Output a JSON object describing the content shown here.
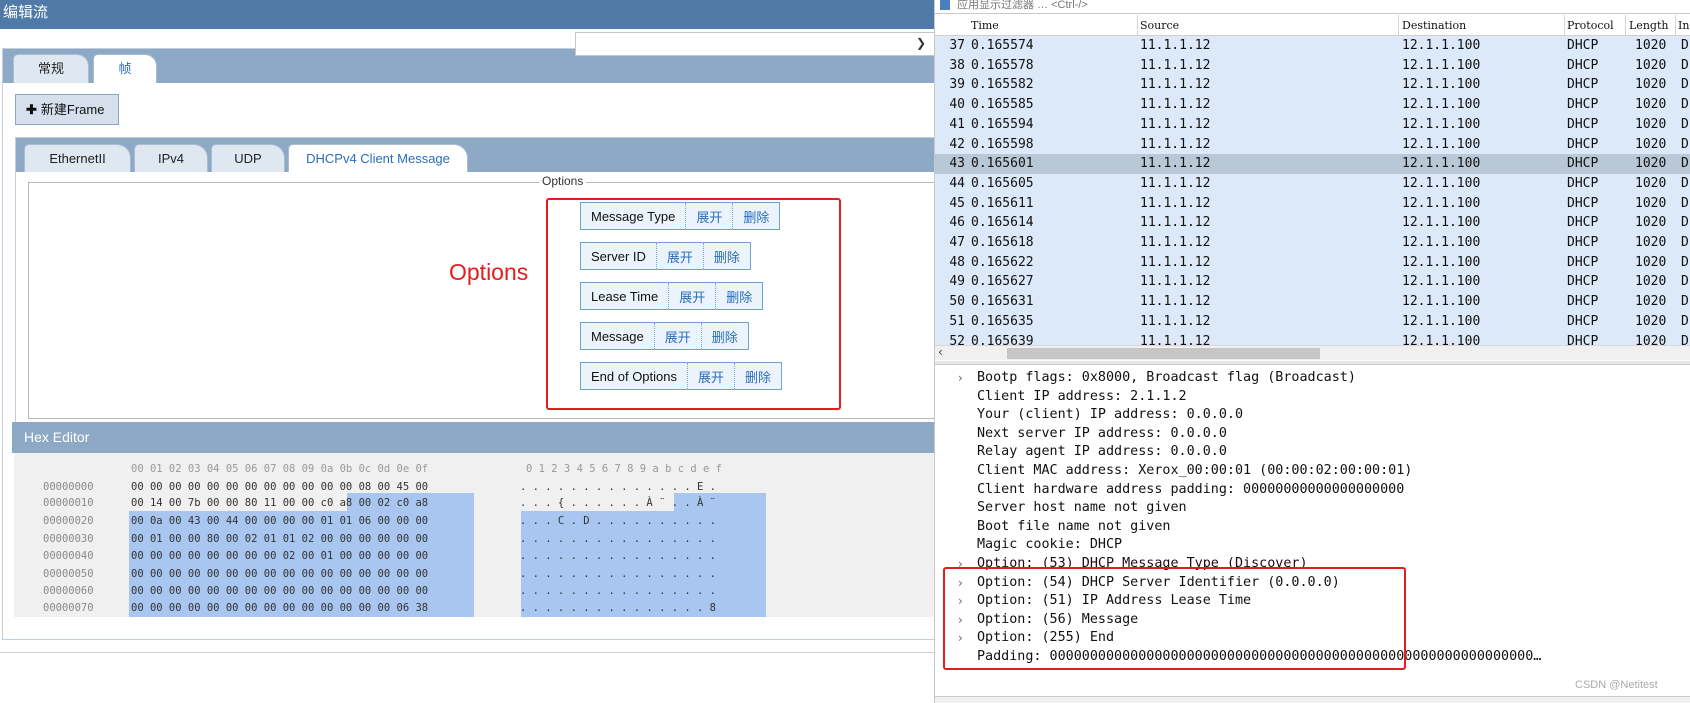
{
  "left_pane": {
    "window_title": "编辑流",
    "top_tabs": [
      {
        "label": "常规"
      },
      {
        "label": "帧"
      }
    ],
    "new_frame_button": "新建Frame",
    "protocol_tabs": [
      {
        "label": "EthernetII"
      },
      {
        "label": "IPv4"
      },
      {
        "label": "UDP"
      },
      {
        "label": "DHCPv4 Client Message"
      }
    ],
    "options_legend": "Options",
    "options_annotation": "Options",
    "options_list": [
      {
        "label": "Message Type",
        "expand": "展开",
        "delete": "删除"
      },
      {
        "label": "Server ID",
        "expand": "展开",
        "delete": "删除"
      },
      {
        "label": "Lease Time",
        "expand": "展开",
        "delete": "删除"
      },
      {
        "label": "Message",
        "expand": "展开",
        "delete": "删除"
      },
      {
        "label": "End of Options",
        "expand": "展开",
        "delete": "删除"
      }
    ],
    "hex_editor": {
      "title": "Hex Editor",
      "column_header_hex": "00 01 02 03 04 05 06 07 08 09 0a 0b 0c 0d 0e 0f",
      "column_header_ascii": "0 1 2 3 4 5 6 7 8 9 a b c d e f",
      "rows": [
        {
          "addr": "00000000",
          "hex": "00 00 00 00 00 00 00 00 00 00 00 00 08 00 45 00",
          "ascii": ". . . . . . . . . . . . . . E ."
        },
        {
          "addr": "00000010",
          "hex": "00 14 00 7b 00 00 80 11 00 00 c0 a8 00 02 c0 a8",
          "ascii": ". . . { . . . . . . À ¨ . . À ¨"
        },
        {
          "addr": "00000020",
          "hex": "00 0a 00 43 00 44 00 00 00 00 01 01 06 00 00 00",
          "ascii": ". . . C . D . . . . . . . . . ."
        },
        {
          "addr": "00000030",
          "hex": "00 01 00 00 80 00 02 01 01 02 00 00 00 00 00 00",
          "ascii": ". . . . . . . . . . . . . . . ."
        },
        {
          "addr": "00000040",
          "hex": "00 00 00 00 00 00 00 00 02 00 01 00 00 00 00 00",
          "ascii": ". . . . . . . . . . . . . . . ."
        },
        {
          "addr": "00000050",
          "hex": "00 00 00 00 00 00 00 00 00 00 00 00 00 00 00 00",
          "ascii": ". . . . . . . . . . . . . . . ."
        },
        {
          "addr": "00000060",
          "hex": "00 00 00 00 00 00 00 00 00 00 00 00 00 00 00 00",
          "ascii": ". . . . . . . . . . . . . . . ."
        },
        {
          "addr": "00000070",
          "hex": "00 00 00 00 00 00 00 00 00 00 00 00 00 00 06 38",
          "ascii": ". . . . . . . . . . . . . . . 8"
        }
      ]
    }
  },
  "right_pane": {
    "filter_placeholder": "应用显示过滤器 … <Ctrl-/>",
    "columns": {
      "time": "Time",
      "source": "Source",
      "destination": "Destination",
      "protocol": "Protocol",
      "length": "Length",
      "info": "In"
    },
    "packets": [
      {
        "no": "37",
        "time": "0.165574",
        "src": "11.1.1.12",
        "dst": "12.1.1.100",
        "proto": "DHCP",
        "len": "1020",
        "info": "D"
      },
      {
        "no": "38",
        "time": "0.165578",
        "src": "11.1.1.12",
        "dst": "12.1.1.100",
        "proto": "DHCP",
        "len": "1020",
        "info": "D"
      },
      {
        "no": "39",
        "time": "0.165582",
        "src": "11.1.1.12",
        "dst": "12.1.1.100",
        "proto": "DHCP",
        "len": "1020",
        "info": "D"
      },
      {
        "no": "40",
        "time": "0.165585",
        "src": "11.1.1.12",
        "dst": "12.1.1.100",
        "proto": "DHCP",
        "len": "1020",
        "info": "D"
      },
      {
        "no": "41",
        "time": "0.165594",
        "src": "11.1.1.12",
        "dst": "12.1.1.100",
        "proto": "DHCP",
        "len": "1020",
        "info": "D"
      },
      {
        "no": "42",
        "time": "0.165598",
        "src": "11.1.1.12",
        "dst": "12.1.1.100",
        "proto": "DHCP",
        "len": "1020",
        "info": "D"
      },
      {
        "no": "43",
        "time": "0.165601",
        "src": "11.1.1.12",
        "dst": "12.1.1.100",
        "proto": "DHCP",
        "len": "1020",
        "info": "D",
        "selected": true
      },
      {
        "no": "44",
        "time": "0.165605",
        "src": "11.1.1.12",
        "dst": "12.1.1.100",
        "proto": "DHCP",
        "len": "1020",
        "info": "D"
      },
      {
        "no": "45",
        "time": "0.165611",
        "src": "11.1.1.12",
        "dst": "12.1.1.100",
        "proto": "DHCP",
        "len": "1020",
        "info": "D"
      },
      {
        "no": "46",
        "time": "0.165614",
        "src": "11.1.1.12",
        "dst": "12.1.1.100",
        "proto": "DHCP",
        "len": "1020",
        "info": "D"
      },
      {
        "no": "47",
        "time": "0.165618",
        "src": "11.1.1.12",
        "dst": "12.1.1.100",
        "proto": "DHCP",
        "len": "1020",
        "info": "D"
      },
      {
        "no": "48",
        "time": "0.165622",
        "src": "11.1.1.12",
        "dst": "12.1.1.100",
        "proto": "DHCP",
        "len": "1020",
        "info": "D"
      },
      {
        "no": "49",
        "time": "0.165627",
        "src": "11.1.1.12",
        "dst": "12.1.1.100",
        "proto": "DHCP",
        "len": "1020",
        "info": "D"
      },
      {
        "no": "50",
        "time": "0.165631",
        "src": "11.1.1.12",
        "dst": "12.1.1.100",
        "proto": "DHCP",
        "len": "1020",
        "info": "D"
      },
      {
        "no": "51",
        "time": "0.165635",
        "src": "11.1.1.12",
        "dst": "12.1.1.100",
        "proto": "DHCP",
        "len": "1020",
        "info": "D"
      },
      {
        "no": "52",
        "time": "0.165639",
        "src": "11.1.1.12",
        "dst": "12.1.1.100",
        "proto": "DHCP",
        "len": "1020",
        "info": "D"
      }
    ],
    "details": [
      {
        "text": "Bootp flags: 0x8000, Broadcast flag (Broadcast)",
        "expandable": true
      },
      {
        "text": "Client IP address: 2.1.1.2",
        "expandable": false
      },
      {
        "text": "Your (client) IP address: 0.0.0.0",
        "expandable": false
      },
      {
        "text": "Next server IP address: 0.0.0.0",
        "expandable": false
      },
      {
        "text": "Relay agent IP address: 0.0.0.0",
        "expandable": false
      },
      {
        "text": "Client MAC address: Xerox_00:00:01 (00:00:02:00:00:01)",
        "expandable": false
      },
      {
        "text": "Client hardware address padding: 00000000000000000000",
        "expandable": false
      },
      {
        "text": "Server host name not given",
        "expandable": false
      },
      {
        "text": "Boot file name not given",
        "expandable": false
      },
      {
        "text": "Magic cookie: DHCP",
        "expandable": false
      },
      {
        "text": "Option: (53) DHCP Message Type (Discover)",
        "expandable": true
      },
      {
        "text": "Option: (54) DHCP Server Identifier (0.0.0.0)",
        "expandable": true
      },
      {
        "text": "Option: (51) IP Address Lease Time",
        "expandable": true
      },
      {
        "text": "Option: (56) Message",
        "expandable": true
      },
      {
        "text": "Option: (255) End",
        "expandable": true
      },
      {
        "text": "Padding: 000000000000000000000000000000000000000000000000000000000000…",
        "expandable": false
      }
    ],
    "watermark": "CSDN @Netitest"
  }
}
